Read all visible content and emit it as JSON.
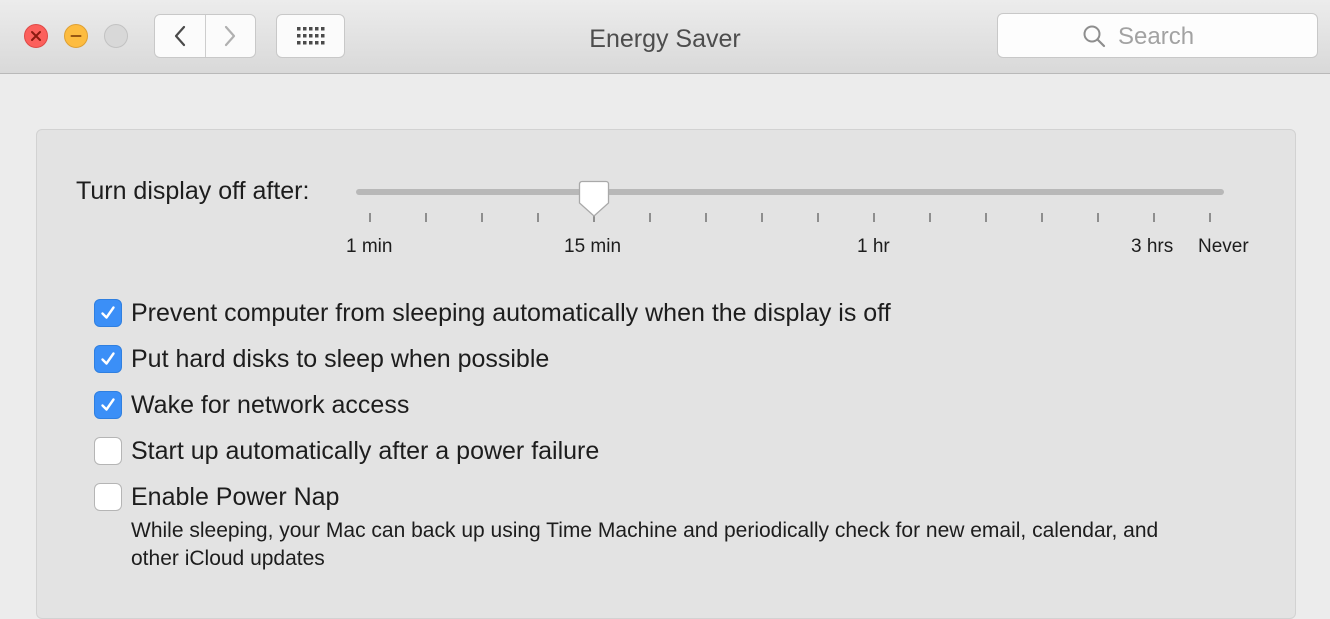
{
  "window": {
    "title": "Energy Saver"
  },
  "toolbar": {
    "back_icon": "chevron-left-icon",
    "forward_icon": "chevron-right-icon",
    "grid_icon": "show-all-grid-icon",
    "search_placeholder": "Search"
  },
  "display_sleep": {
    "label": "Turn display off after:",
    "selected": "15 min",
    "tick_labels": [
      "1 min",
      "15 min",
      "1 hr",
      "3 hrs",
      "Never"
    ]
  },
  "options": [
    {
      "label": "Prevent computer from sleeping automatically when the display is off",
      "checked": true
    },
    {
      "label": "Put hard disks to sleep when possible",
      "checked": true
    },
    {
      "label": "Wake for network access",
      "checked": true
    },
    {
      "label": "Start up automatically after a power failure",
      "checked": false
    },
    {
      "label": "Enable Power Nap",
      "checked": false
    }
  ],
  "power_nap_description": "While sleeping, your Mac can back up using Time Machine and periodically check for new email, calendar, and other iCloud updates",
  "colors": {
    "accent": "#3b8ff7",
    "close": "#fc605c",
    "minimize": "#fdbc40"
  }
}
